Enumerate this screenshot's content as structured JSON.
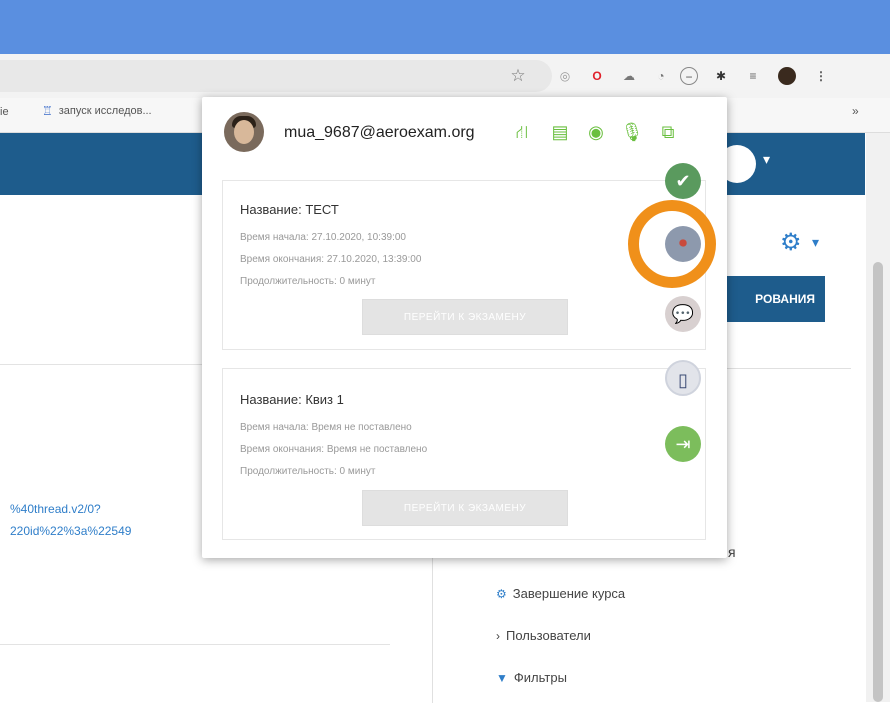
{
  "browser": {
    "bookmark_label": "ie",
    "bookmark_item": "запуск исследов...",
    "bookmark_overflow": "»",
    "ext_icons": [
      "lens-icon",
      "opera-icon",
      "cloud-icon",
      "speedometer-icon",
      "minus-icon",
      "puzzle-icon",
      "playlist-icon",
      "profile-icon",
      "menu-icon"
    ]
  },
  "page": {
    "button_label": "РОВАНИЯ",
    "url_line1": "%40thread.v2/0?",
    "url_line2": "220id%22%3a%22549",
    "side_stub": "я",
    "side_links": [
      {
        "icon": "gear-icon",
        "label": "Завершение курса"
      },
      {
        "icon": "chevron-right-icon",
        "label": "Пользователи"
      },
      {
        "icon": "filter-icon",
        "label": "Фильтры"
      }
    ]
  },
  "popup": {
    "email": "mua_9687@aeroexam.org",
    "exams": [
      {
        "title": "Название: ТЕСТ",
        "start": "Время начала: 27.10.2020, 10:39:00",
        "end": "Время окончания: 27.10.2020, 13:39:00",
        "duration": "Продолжительность: 0 минут",
        "button": "ПЕРЕЙТИ К ЭКЗАМЕНУ"
      },
      {
        "title": "Название: Квиз 1",
        "start": "Время начала: Время не поставлено",
        "end": "Время окончания: Время не поставлено",
        "duration": "Продолжительность: 0 минут",
        "button": "ПЕРЕЙТИ К ЭКЗАМЕНУ"
      }
    ]
  },
  "colors": {
    "chrome_blue": "#5a8fe0",
    "navbar": "#1e5c8c",
    "highlight": "#f0901a",
    "tool_green": "#6abf3f"
  }
}
